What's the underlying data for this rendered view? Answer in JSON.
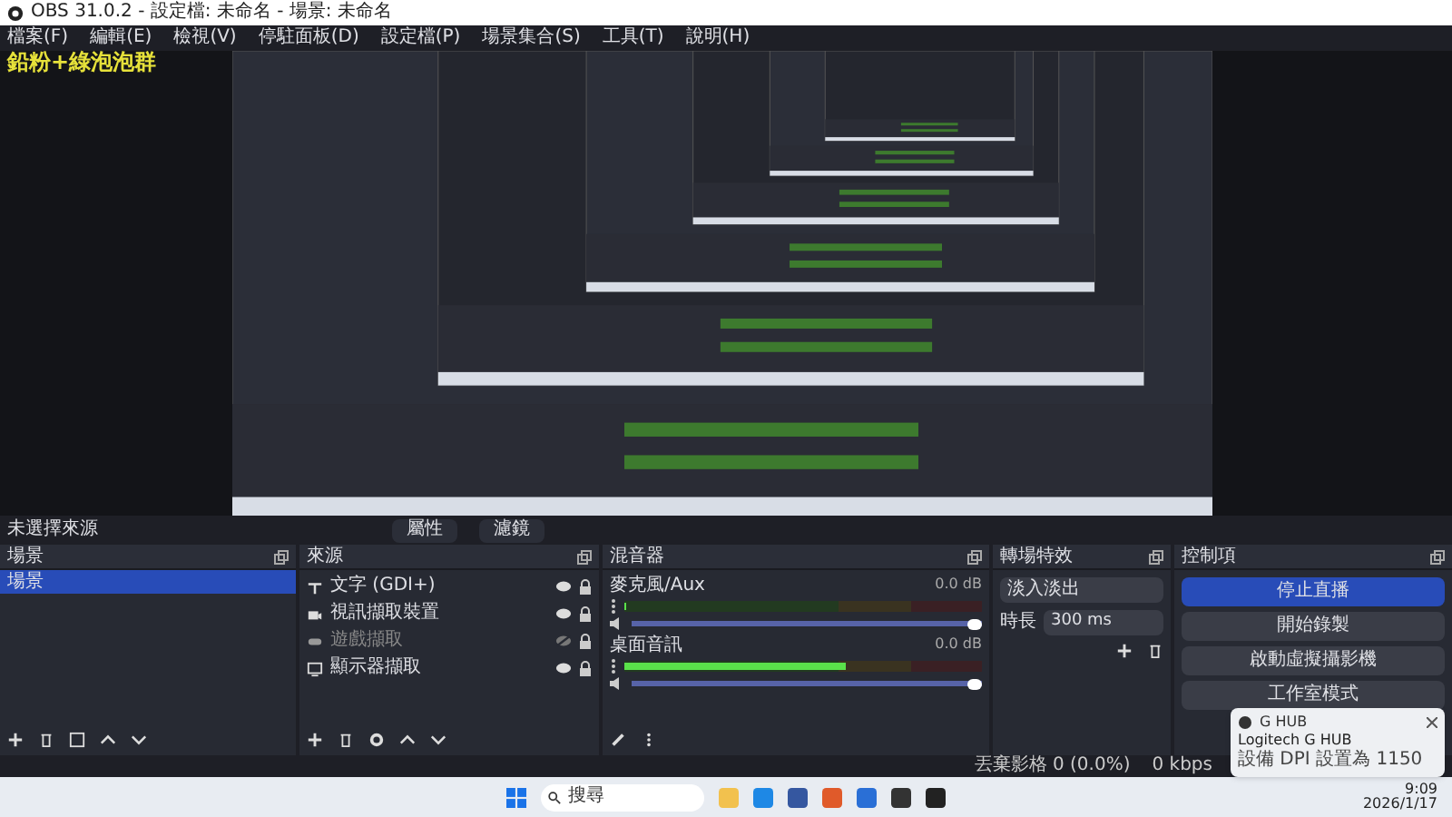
{
  "window": {
    "title": "OBS 31.0.2 - 設定檔: 未命名 - 場景: 未命名"
  },
  "menu": [
    "檔案(F)",
    "編輯(E)",
    "檢視(V)",
    "停駐面板(D)",
    "設定檔(P)",
    "場景集合(S)",
    "工具(T)",
    "說明(H)"
  ],
  "preview": {
    "overlay_text": "鉛粉+綠泡泡群"
  },
  "context_bar": {
    "label": "未選擇來源",
    "buttons": [
      "屬性",
      "濾鏡"
    ]
  },
  "scenes": {
    "title": "場景",
    "items": [
      {
        "name": "場景",
        "selected": true
      }
    ]
  },
  "sources": {
    "title": "來源",
    "items": [
      {
        "name": "文字 (GDI+)",
        "kind": "text",
        "visible": true,
        "locked": true
      },
      {
        "name": "視訊擷取裝置",
        "kind": "camera",
        "visible": true,
        "locked": true
      },
      {
        "name": "遊戲擷取",
        "kind": "game",
        "visible": false,
        "locked": true
      },
      {
        "name": "顯示器擷取",
        "kind": "monitor",
        "visible": true,
        "locked": true
      }
    ]
  },
  "mixer": {
    "title": "混音器",
    "channels": [
      {
        "name": "麥克風/Aux",
        "reading": "0.0 dB",
        "meter": {
          "level": 0
        },
        "volume": {
          "level": 1
        }
      },
      {
        "name": "桌面音訊",
        "reading": "0.0 dB",
        "meter": {
          "level": 0.62
        },
        "volume": {
          "level": 1
        }
      }
    ]
  },
  "transitions": {
    "title": "轉場特效",
    "type": "淡入淡出",
    "duration_label": "時長",
    "duration": "300 ms"
  },
  "controls": {
    "title": "控制項",
    "buttons": [
      {
        "label": "停止直播",
        "active": true
      },
      {
        "label": "開始錄製",
        "active": false
      },
      {
        "label": "啟動虛擬攝影機",
        "active": false
      },
      {
        "label": "工作室模式",
        "active": false
      }
    ]
  },
  "notification": {
    "app": "G HUB",
    "title": "Logitech G HUB",
    "message": "設備 DPI 設置為 1150"
  },
  "status_bar": [
    "丟棄影格 0 (0.0%)",
    "0 kbps"
  ],
  "taskbar": {
    "search": "搜尋",
    "time": "9:09",
    "date": "2026/1/17"
  }
}
